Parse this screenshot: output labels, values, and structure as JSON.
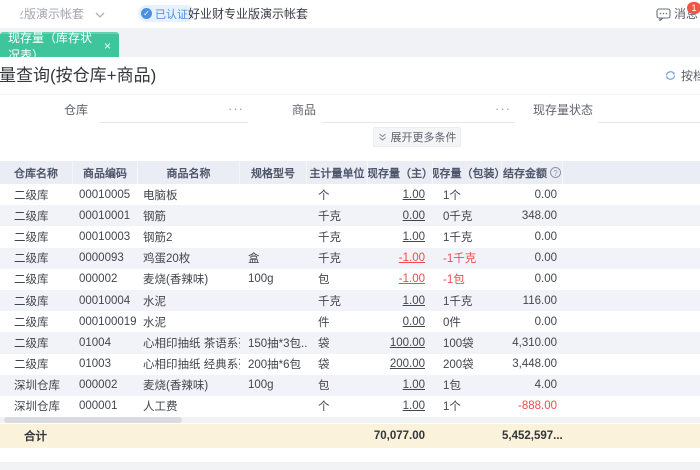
{
  "colors": {
    "tab_green": "#3ec59b",
    "negative_red": "#f04b4b",
    "total_row_bg": "#fbf2dc",
    "header_bg": "#ebedf4",
    "row_stripe": "#f2f3f8",
    "accent_blue": "#4a8fe2",
    "badge_red": "#f25643"
  },
  "topbar": {
    "account_selector": "专业版演示帐套",
    "verified_badge": "已认证",
    "account_name": "好业财专业版演示帐套",
    "messages_label": "消息",
    "messages_count": "1"
  },
  "tabbar": {
    "active_tab": "现存量（库存状况表）",
    "close": "×"
  },
  "page": {
    "title": "现存量查询(按仓库+商品)",
    "view_switch_label": "按档"
  },
  "filters": {
    "warehouse_label": "仓库",
    "product_label": "商品",
    "status_label": "现存量状态",
    "picker_ellipsis": "···",
    "expand_more_label": "展开更多条件"
  },
  "table": {
    "columns": [
      "仓库名称",
      "商品编码",
      "商品名称",
      "规格型号",
      "主计量单位",
      "现存量（主）",
      "现存量（包装）",
      "结存金额"
    ],
    "help_icon": "?",
    "rows": [
      {
        "warehouse": "二级库",
        "code": "00010005",
        "name": "电脑板",
        "spec": "",
        "unit": "个",
        "qty": "1.00",
        "pkg": "1个",
        "amount": "0.00"
      },
      {
        "warehouse": "二级库",
        "code": "00010001",
        "name": "钢筋",
        "spec": "",
        "unit": "千克",
        "qty": "0.00",
        "pkg": "0千克",
        "amount": "348.00"
      },
      {
        "warehouse": "二级库",
        "code": "00010003",
        "name": "钢筋2",
        "spec": "",
        "unit": "千克",
        "qty": "1.00",
        "pkg": "1千克",
        "amount": "0.00"
      },
      {
        "warehouse": "二级库",
        "code": "0000093",
        "name": "鸡蛋20枚",
        "spec": "盒",
        "unit": "千克",
        "qty": "-1.00",
        "pkg": "-1千克",
        "amount": "0.00"
      },
      {
        "warehouse": "二级库",
        "code": "000002",
        "name": "麦烧(香辣味)",
        "spec": "100g",
        "unit": "包",
        "qty": "-1.00",
        "pkg": "-1包",
        "amount": "0.00"
      },
      {
        "warehouse": "二级库",
        "code": "00010004",
        "name": "水泥",
        "spec": "",
        "unit": "千克",
        "qty": "1.00",
        "pkg": "1千克",
        "amount": "116.00"
      },
      {
        "warehouse": "二级库",
        "code": "000100019",
        "name": "水泥",
        "spec": "",
        "unit": "件",
        "qty": "0.00",
        "pkg": "0件",
        "amount": "0.00"
      },
      {
        "warehouse": "二级库",
        "code": "01004",
        "name": "心相印抽纸 茶语系列 ...",
        "spec": "150抽*3包...",
        "unit": "袋",
        "qty": "100.00",
        "pkg": "100袋",
        "amount": "4,310.00"
      },
      {
        "warehouse": "二级库",
        "code": "01003",
        "name": "心相印抽纸 经典系列",
        "spec": "200抽*6包",
        "unit": "袋",
        "qty": "200.00",
        "pkg": "200袋",
        "amount": "3,448.00"
      },
      {
        "warehouse": "深圳仓库",
        "code": "000002",
        "name": "麦烧(香辣味)",
        "spec": "100g",
        "unit": "包",
        "qty": "1.00",
        "pkg": "1包",
        "amount": "4.00"
      },
      {
        "warehouse": "深圳仓库",
        "code": "000001",
        "name": "人工费",
        "spec": "",
        "unit": "个",
        "qty": "1.00",
        "pkg": "1个",
        "amount": "-888.00"
      }
    ],
    "total": {
      "label": "合计",
      "qty": "70,077.00",
      "amount": "5,452,597...."
    }
  }
}
